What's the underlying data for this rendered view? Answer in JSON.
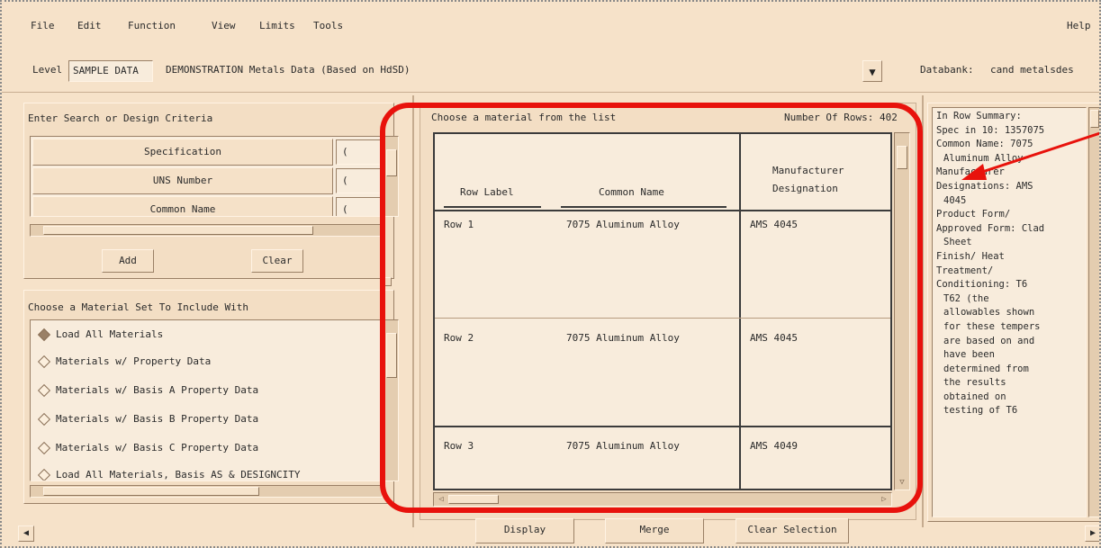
{
  "menu": {
    "file": "File",
    "edit": "Edit",
    "function": "Function",
    "view": "View",
    "limits": "Limits",
    "tools": "Tools",
    "help": "Help"
  },
  "toolbar": {
    "level_label": "Level",
    "level_value": "SAMPLE DATA",
    "level_description": "DEMONSTRATION Metals Data (Based on HdSD)",
    "databank_label": "Databank:",
    "databank_value": "cand metalsdes"
  },
  "search_panel": {
    "title": "Enter Search or Design Criteria",
    "criteria": [
      {
        "label": "Specification",
        "value": "("
      },
      {
        "label": "UNS Number",
        "value": "("
      },
      {
        "label": "Common Name",
        "value": "("
      }
    ],
    "add_button": "Add",
    "clear_button": "Clear"
  },
  "property_panel": {
    "title": "Choose a Material Set To Include With",
    "options": [
      {
        "label": "Load All Materials",
        "selected": true
      },
      {
        "label": "Materials w/ Property Data",
        "selected": false
      },
      {
        "label": "Materials w/ Basis A Property Data",
        "selected": false
      },
      {
        "label": "Materials w/ Basis B Property Data",
        "selected": false
      },
      {
        "label": "Materials w/ Basis C Property Data",
        "selected": false
      },
      {
        "label": "Load All Materials, Basis AS & DESIGNCITY",
        "selected": false
      }
    ]
  },
  "material_list": {
    "title": "Choose a material from the list",
    "number_label": "Number Of Rows: 402",
    "columns": {
      "row_label": "Row Label",
      "common_name": "Common Name",
      "manufacturer_line1": "Manufacturer",
      "manufacturer_line2": "Designation"
    },
    "rows": [
      {
        "label": "Row 1",
        "name": "7075 Aluminum Alloy",
        "designation": "AMS 4045"
      },
      {
        "label": "Row 2",
        "name": "7075 Aluminum Alloy",
        "designation": "AMS 4045"
      },
      {
        "label": "Row 3",
        "name": "7075 Aluminum Alloy",
        "designation": "AMS 4049"
      }
    ]
  },
  "bottom_buttons": {
    "display": "Display",
    "merge": "Merge",
    "clear_selection": "Clear Selection"
  },
  "info_panel": {
    "lines": [
      "In Row Summary:",
      "Spec in 10: 1357075",
      "Common Name: 7075",
      "Aluminum Alloy",
      "Manufacturer",
      "Designations: AMS",
      "4045",
      "Product Form/",
      "Approved Form: Clad",
      "Sheet",
      "Finish/ Heat",
      "Treatment/",
      "Conditioning: T6",
      "T62 (the",
      "allowables shown",
      "for these tempers",
      "are based on and",
      "have been",
      "determined from",
      "the results",
      "obtained on",
      "testing of T6"
    ]
  },
  "annotation": {
    "highlight_color": "#e8120c"
  }
}
